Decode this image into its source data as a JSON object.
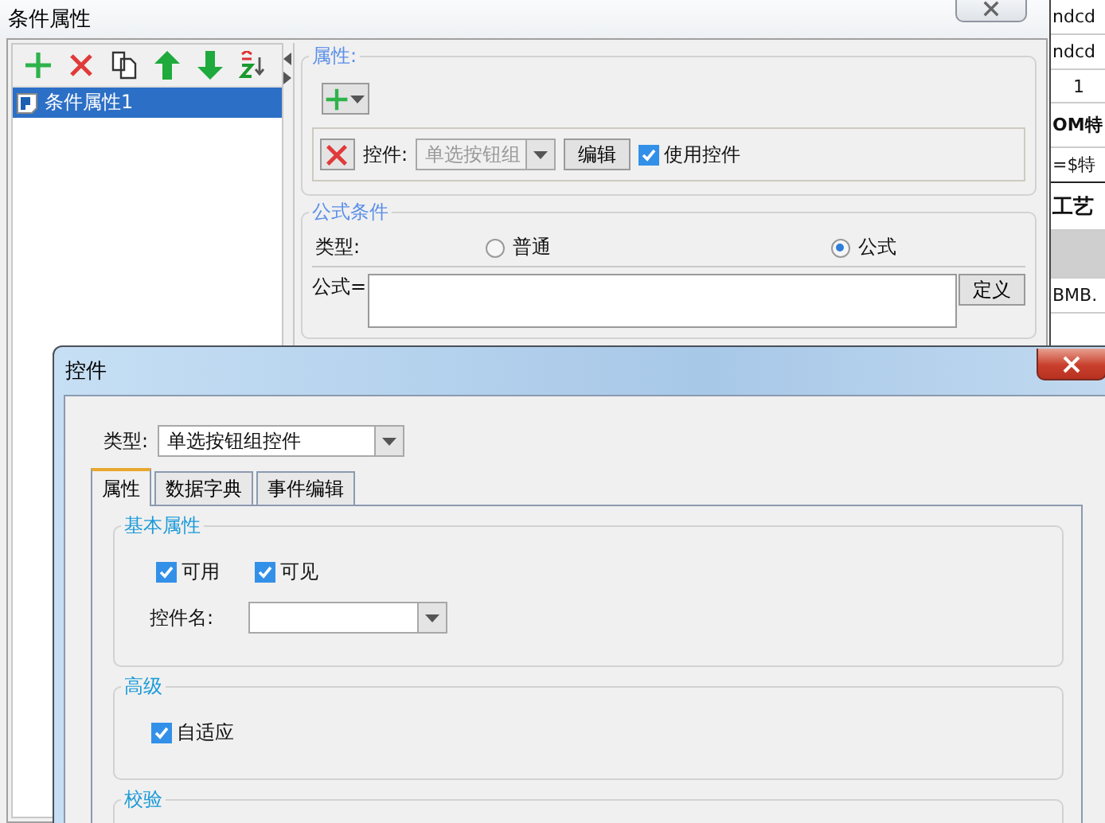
{
  "condition_window": {
    "title": "条件属性",
    "list": [
      {
        "label": "条件属性1",
        "selected": true
      }
    ],
    "property_group": {
      "title": "属性:",
      "control_label": "控件:",
      "control_select": {
        "value": "单选按钮组",
        "disabled": true
      },
      "edit_button": "编辑",
      "use_control": {
        "label": "使用控件",
        "checked": true
      }
    },
    "formula_group": {
      "title": "公式条件",
      "type_label": "类型:",
      "type_options": [
        {
          "label": "普通",
          "selected": false
        },
        {
          "label": "公式",
          "selected": true
        }
      ],
      "formula_label": "公式=",
      "define_button": "定义"
    }
  },
  "sheet_cells": [
    {
      "text": "ndcd",
      "kind": "plain"
    },
    {
      "text": "ndcd",
      "kind": "plain"
    },
    {
      "text": "1",
      "kind": "center"
    },
    {
      "text": "OM特",
      "kind": "bold"
    },
    {
      "text": "=$特",
      "kind": "plain"
    },
    {
      "text": "工艺",
      "kind": "heading"
    },
    {
      "text": "",
      "kind": "shaded"
    },
    {
      "text": "BMB.",
      "kind": "plain"
    }
  ],
  "control_dialog": {
    "title": "控件",
    "type_label": "类型:",
    "type_value": "单选按钮组控件",
    "tabs": [
      {
        "label": "属性",
        "selected": true
      },
      {
        "label": "数据字典",
        "selected": false
      },
      {
        "label": "事件编辑",
        "selected": false
      }
    ],
    "basic_group": {
      "title": "基本属性",
      "checkboxes": [
        {
          "label": "可用",
          "checked": true
        },
        {
          "label": "可见",
          "checked": true
        }
      ],
      "name_label": "控件名:"
    },
    "advanced_group": {
      "title": "高级",
      "checkboxes": [
        {
          "label": "自适应",
          "checked": true
        }
      ]
    },
    "validation_group": {
      "title": "校验"
    }
  }
}
